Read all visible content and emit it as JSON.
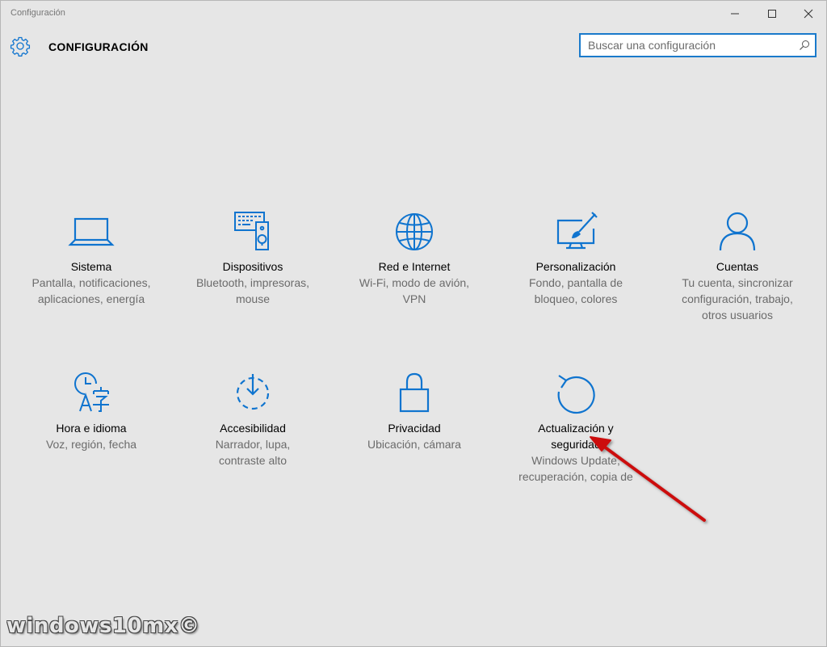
{
  "window": {
    "title": "Configuración",
    "minimize_icon": "minimize-icon",
    "maximize_icon": "maximize-icon",
    "close_icon": "close-icon"
  },
  "header": {
    "title": "CONFIGURACIÓN",
    "icon": "gear-icon"
  },
  "search": {
    "placeholder": "Buscar una configuración",
    "value": "",
    "icon": "search-icon"
  },
  "accent_color": "#0f74cf",
  "tiles": [
    {
      "id": "sistema",
      "icon": "laptop-icon",
      "name": "Sistema",
      "desc": [
        "Pantalla, notificaciones,",
        "aplicaciones, energía"
      ]
    },
    {
      "id": "dispositivos",
      "icon": "devices-icon",
      "name": "Dispositivos",
      "desc": [
        "Bluetooth, impresoras,",
        "mouse"
      ]
    },
    {
      "id": "red",
      "icon": "globe-icon",
      "name": "Red e Internet",
      "desc": [
        "Wi-Fi, modo de avión,",
        "VPN"
      ]
    },
    {
      "id": "personalizacion",
      "icon": "paint-icon",
      "name": "Personalización",
      "desc": [
        "Fondo, pantalla de",
        "bloqueo, colores"
      ]
    },
    {
      "id": "cuentas",
      "icon": "person-icon",
      "name": "Cuentas",
      "desc": [
        "Tu cuenta, sincronizar",
        "configuración, trabajo,",
        "otros usuarios"
      ]
    },
    {
      "id": "hora",
      "icon": "time-language-icon",
      "name": "Hora e idioma",
      "desc": [
        "Voz, región, fecha"
      ]
    },
    {
      "id": "accesibilidad",
      "icon": "accessibility-icon",
      "name": "Accesibilidad",
      "desc": [
        "Narrador, lupa,",
        "contraste alto"
      ]
    },
    {
      "id": "privacidad",
      "icon": "lock-icon",
      "name": "Privacidad",
      "desc": [
        "Ubicación, cámara"
      ]
    },
    {
      "id": "actualizacion",
      "icon": "update-icon",
      "name": [
        "Actualización y",
        "seguridad"
      ],
      "desc": [
        "Windows Update,",
        "recuperación, copia de"
      ]
    }
  ],
  "annotation": {
    "arrow_color": "#cc1010"
  },
  "watermark": "windows10mx©"
}
